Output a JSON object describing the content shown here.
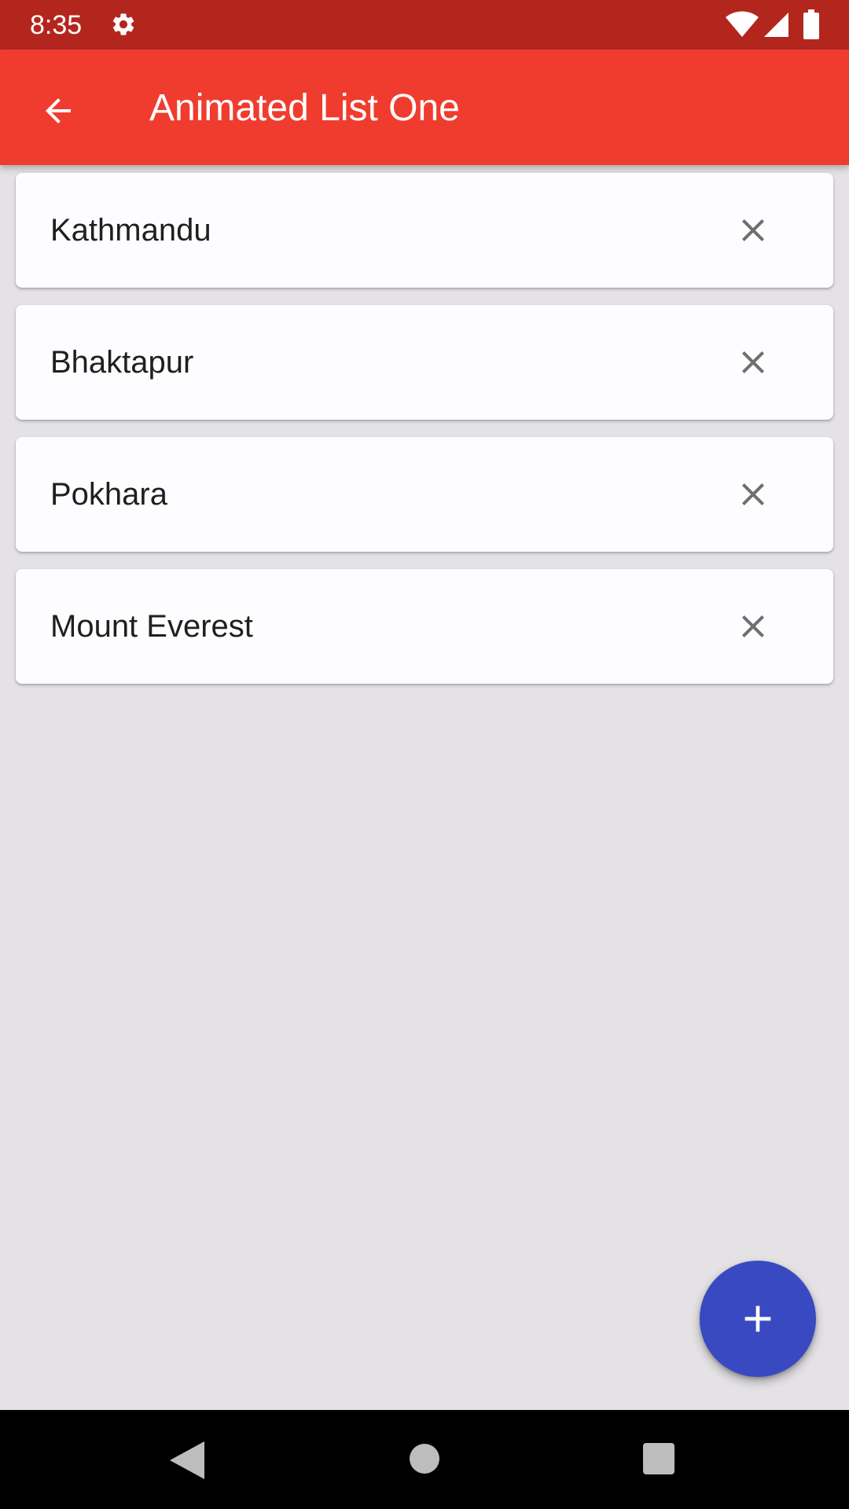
{
  "status_bar": {
    "time": "8:35",
    "icons": [
      "gear-icon",
      "wifi-icon",
      "signal-icon",
      "battery-icon"
    ]
  },
  "app_bar": {
    "title": "Animated List One",
    "nav_icon": "arrow-back-icon",
    "background": "#f03c2e"
  },
  "list": {
    "items": [
      {
        "label": "Kathmandu",
        "action_icon": "close-icon"
      },
      {
        "label": "Bhaktapur",
        "action_icon": "close-icon"
      },
      {
        "label": "Pokhara",
        "action_icon": "close-icon"
      },
      {
        "label": "Mount Everest",
        "action_icon": "close-icon"
      }
    ]
  },
  "fab": {
    "icon": "add-icon",
    "color": "#3949c2"
  },
  "nav_bar": {
    "icons": [
      "nav-back-icon",
      "nav-home-icon",
      "nav-recents-icon"
    ]
  },
  "colors": {
    "status_bar": "#b3261e",
    "background": "#e4e2e4",
    "card": "#fdfcff",
    "icon_gray": "#6f6f6f"
  }
}
